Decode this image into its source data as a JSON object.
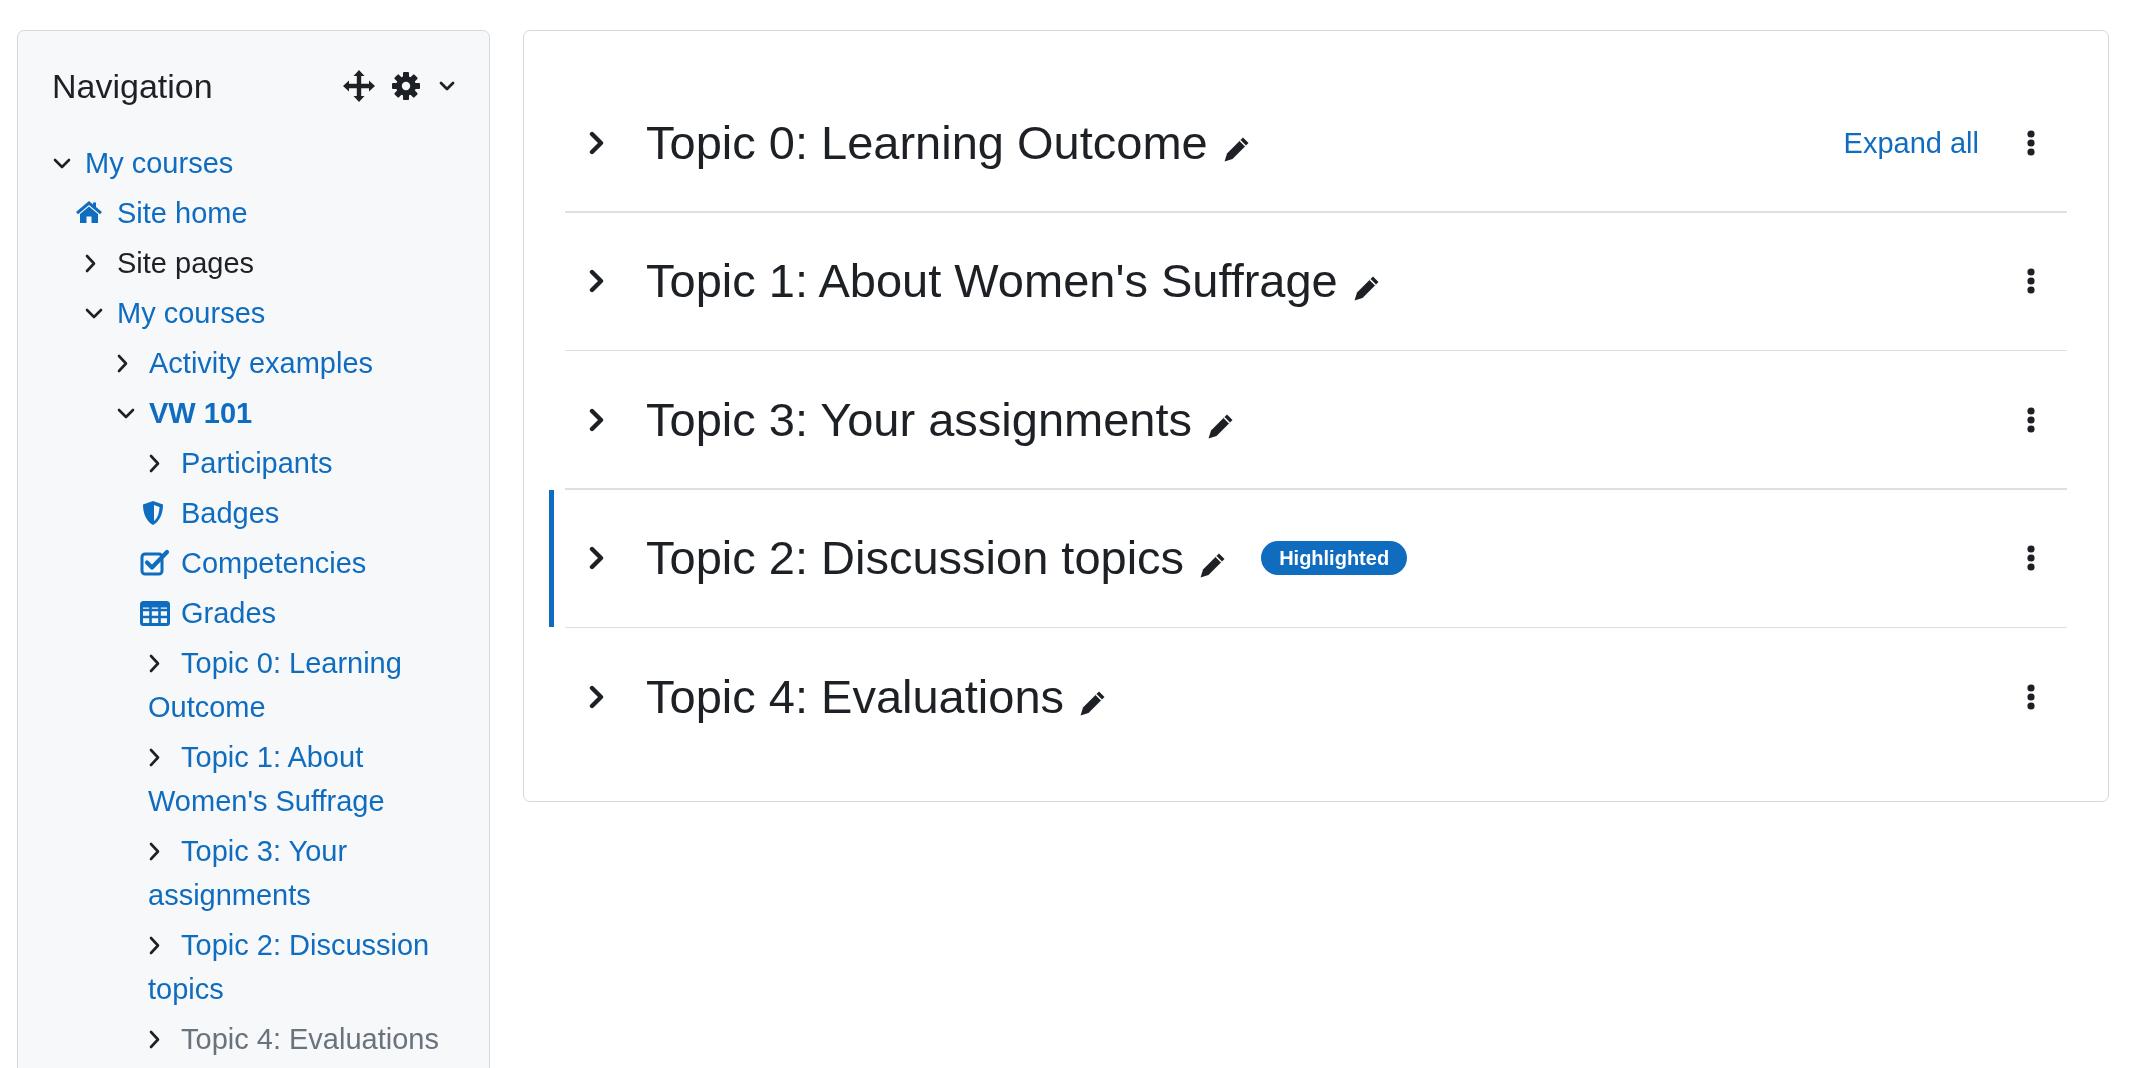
{
  "navigation": {
    "title": "Navigation",
    "tree": [
      {
        "label": "My courses",
        "kind": "branch",
        "expanded": true,
        "link": true,
        "current": false,
        "dimmed": false,
        "children": [
          {
            "label": "Site home",
            "kind": "home",
            "link": true,
            "current": false,
            "dimmed": false
          },
          {
            "label": "Site pages",
            "kind": "branch",
            "expanded": false,
            "link": false,
            "current": false,
            "dimmed": false
          },
          {
            "label": "My courses",
            "kind": "branch",
            "expanded": true,
            "link": true,
            "current": false,
            "dimmed": false,
            "children": [
              {
                "label": "Activity examples",
                "kind": "branch",
                "expanded": false,
                "link": true,
                "current": false,
                "dimmed": false
              },
              {
                "label": "VW 101",
                "kind": "branch",
                "expanded": true,
                "link": true,
                "current": true,
                "dimmed": false,
                "children": [
                  {
                    "label": "Participants",
                    "kind": "branch",
                    "expanded": false,
                    "link": true,
                    "current": false,
                    "dimmed": false
                  },
                  {
                    "label": "Badges",
                    "kind": "badges",
                    "link": true,
                    "current": false,
                    "dimmed": false
                  },
                  {
                    "label": "Competencies",
                    "kind": "competencies",
                    "link": true,
                    "current": false,
                    "dimmed": false
                  },
                  {
                    "label": "Grades",
                    "kind": "grades",
                    "link": true,
                    "current": false,
                    "dimmed": false
                  },
                  {
                    "label": "Topic 0: Learning Outcome",
                    "kind": "branch",
                    "expanded": false,
                    "link": true,
                    "current": false,
                    "dimmed": false
                  },
                  {
                    "label": "Topic 1: About Women's Suffrage",
                    "kind": "branch",
                    "expanded": false,
                    "link": true,
                    "current": false,
                    "dimmed": false
                  },
                  {
                    "label": "Topic 3: Your assignments",
                    "kind": "branch",
                    "expanded": false,
                    "link": true,
                    "current": false,
                    "dimmed": false
                  },
                  {
                    "label": "Topic 2: Discussion topics",
                    "kind": "branch",
                    "expanded": false,
                    "link": true,
                    "current": false,
                    "dimmed": false
                  },
                  {
                    "label": "Topic 4: Evaluations",
                    "kind": "branch",
                    "expanded": false,
                    "link": true,
                    "current": false,
                    "dimmed": true
                  }
                ]
              }
            ]
          }
        ]
      }
    ]
  },
  "course": {
    "expand_all": "Expand all",
    "sections": [
      {
        "title": "Topic 0: Learning Outcome",
        "expanded": false,
        "highlighted": false
      },
      {
        "title": "Topic 1: About Women's Suffrage",
        "expanded": false,
        "highlighted": false
      },
      {
        "title": "Topic 3: Your assignments",
        "expanded": false,
        "highlighted": false
      },
      {
        "title": "Topic 2: Discussion topics",
        "expanded": false,
        "highlighted": true,
        "badge": "Highlighted"
      },
      {
        "title": "Topic 4: Evaluations",
        "expanded": false,
        "highlighted": false
      }
    ]
  }
}
